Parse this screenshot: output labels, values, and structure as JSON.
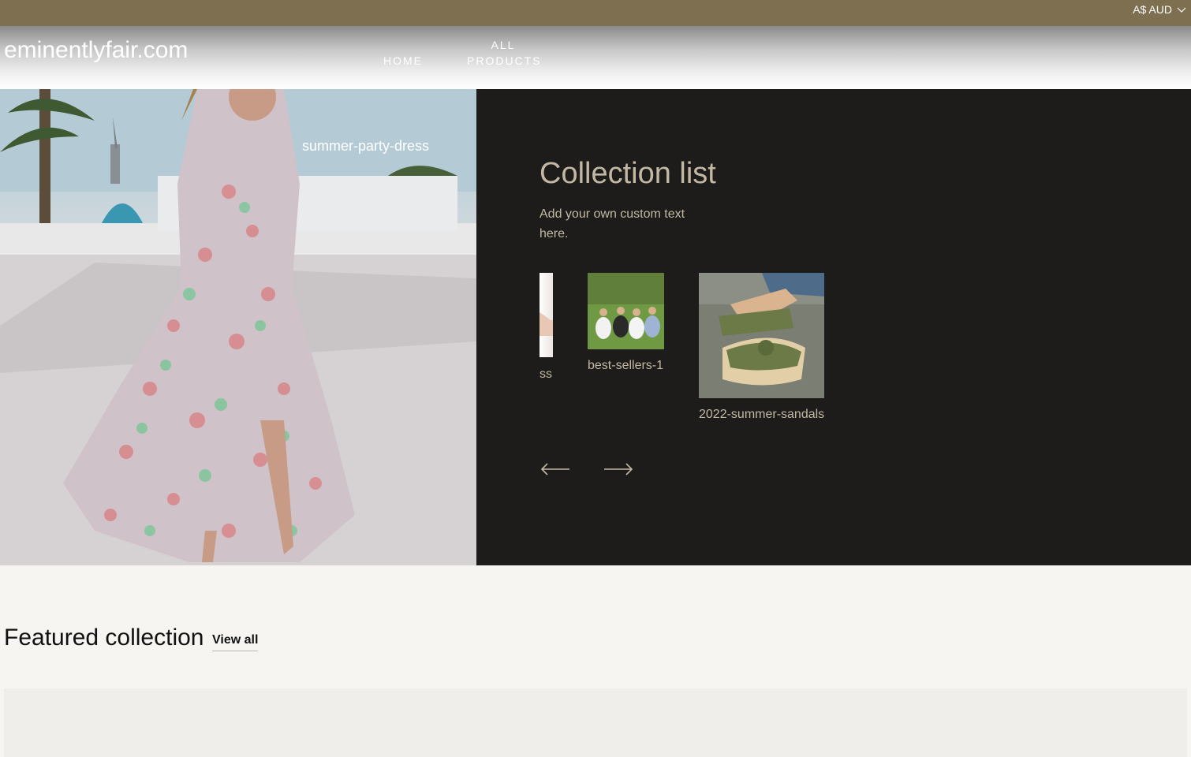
{
  "topbar": {
    "currency": "A$ AUD",
    "currency_icon": "chevron-down-icon",
    "background": "#7e6f50"
  },
  "header": {
    "logo": "eminentlyfair.com",
    "nav": [
      {
        "label": "HOME"
      },
      {
        "label": "ALL PRODUCTS"
      }
    ]
  },
  "hero": {
    "image_caption": "summer-party-dress",
    "panel": {
      "title": "Collection list",
      "text": "Add your own custom text here.",
      "background": "#1e1c1b",
      "text_color": "#c2b8a3"
    },
    "collections": [
      {
        "label": "ss"
      },
      {
        "label": "best-sellers-1"
      },
      {
        "label": "2022-summer-sandals"
      }
    ],
    "prev_icon": "arrow-left-icon",
    "next_icon": "arrow-right-icon"
  },
  "featured": {
    "title": "Featured collection",
    "view_all": "View all"
  }
}
